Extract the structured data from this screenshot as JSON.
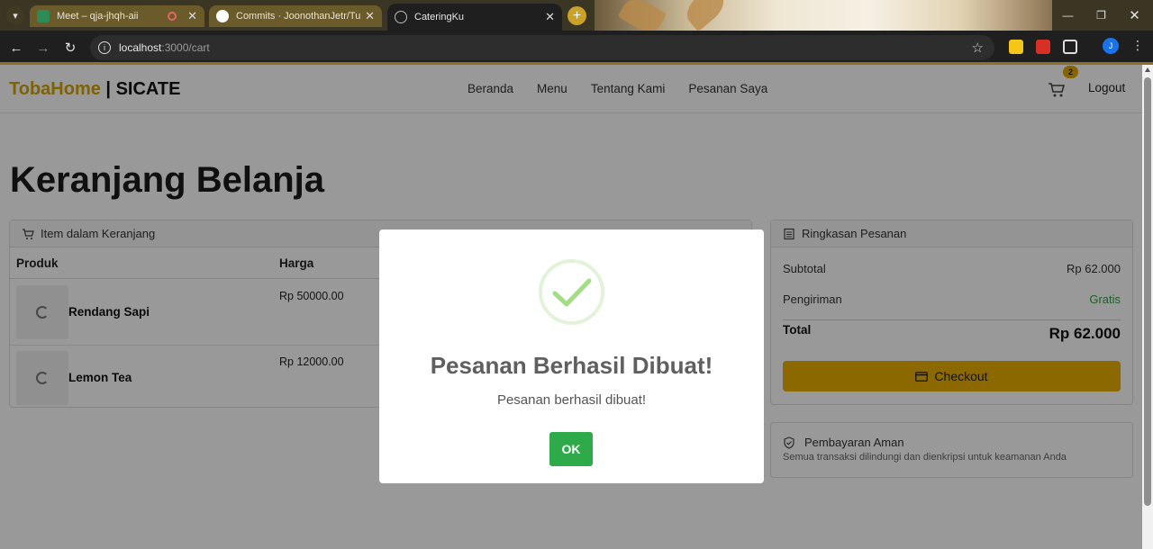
{
  "browser": {
    "tabs": [
      {
        "title": "Meet – qja-jhqh-aii",
        "favicon": "meet-icon"
      },
      {
        "title": "Commits · JoonothanJetr/Tuber",
        "favicon": "github-icon"
      },
      {
        "title": "CateringKu",
        "favicon": "globe-icon"
      }
    ],
    "url_host": "localhost",
    "url_path": ":3000/cart",
    "profile_initial": "J"
  },
  "navbar": {
    "brand_accent": "TobaHome",
    "brand_rest": " | SICATE",
    "links": [
      "Beranda",
      "Menu",
      "Tentang Kami",
      "Pesanan Saya"
    ],
    "cart_count": "2",
    "logout": "Logout"
  },
  "page": {
    "title": "Keranjang Belanja"
  },
  "cart": {
    "header": "Item dalam Keranjang",
    "columns": [
      "Produk",
      "Harga"
    ],
    "items": [
      {
        "name": "Rendang Sapi",
        "price": "Rp 50000.00"
      },
      {
        "name": "Lemon Tea",
        "price": "Rp 12000.00"
      }
    ]
  },
  "summary": {
    "header": "Ringkasan Pesanan",
    "subtotal_label": "Subtotal",
    "subtotal_value": "Rp 62.000",
    "shipping_label": "Pengiriman",
    "shipping_value": "Gratis",
    "total_label": "Total",
    "total_value": "Rp 62.000",
    "checkout_label": "Checkout"
  },
  "secure": {
    "title": "Pembayaran Aman",
    "subtitle": "Semua transaksi dilindungi dan dienkripsi untuk keamanan Anda"
  },
  "modal": {
    "title": "Pesanan Berhasil Dibuat!",
    "message": "Pesanan berhasil dibuat!",
    "ok_label": "OK"
  },
  "colors": {
    "brand_accent": "#d4a20a",
    "checkout_button": "#e8ad00",
    "ok_button": "#2eaa4a",
    "success_check": "#a5dc86",
    "free_shipping": "#2f9e44"
  }
}
